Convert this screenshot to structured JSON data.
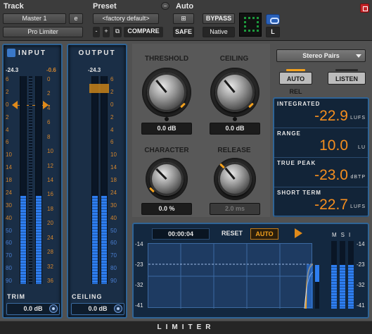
{
  "header": {
    "track_label": "Track",
    "preset_label": "Preset",
    "auto_label": "Auto",
    "track_name": "Master 1",
    "track_e": "e",
    "plugin_name": "Pro Limiter",
    "preset_name": "<factory default>",
    "minus": "-",
    "plus": "+",
    "compare": "COMPARE",
    "safe": "SAFE",
    "bypass": "BYPASS",
    "native": "Native",
    "link_l": "L"
  },
  "input_meter": {
    "title": "INPUT",
    "peak_left": "-24.3",
    "peak_right": "-0.6",
    "scale_orange": [
      "0",
      "2",
      "4",
      "6",
      "8",
      "10",
      "12",
      "14",
      "16",
      "18",
      "20",
      "24",
      "28",
      "32",
      "36"
    ],
    "scale_blue": [
      "50",
      "60",
      "70",
      "80",
      "90"
    ],
    "scale_left": [
      "6",
      "2",
      "0",
      "2",
      "4",
      "6",
      "10",
      "14",
      "18",
      "24",
      "30",
      "40",
      "50",
      "60",
      "70",
      "80",
      "90"
    ],
    "trim_label": "TRIM",
    "trim_value": "0.0 dB"
  },
  "output_meter": {
    "title": "OUTPUT",
    "peak": "-24.3",
    "scale": [
      "6",
      "2",
      "0",
      "2",
      "4",
      "6",
      "10",
      "14",
      "18",
      "24",
      "30",
      "40",
      "50",
      "60",
      "70",
      "80",
      "90"
    ],
    "ceiling_label": "CEILING",
    "ceiling_value": "0.0 dB"
  },
  "knobs": {
    "threshold_label": "THRESHOLD",
    "threshold_value": "0.0 dB",
    "ceiling_label": "CEILING",
    "ceiling_value": "0.0 dB",
    "character_label": "CHARACTER",
    "character_value": "0.0 %",
    "release_label": "RELEASE",
    "release_value": "2.0 ms"
  },
  "controls": {
    "stereo_mode": "Stereo Pairs",
    "auto_rel": "AUTO REL",
    "listen": "LISTEN"
  },
  "loudness": {
    "rows": [
      {
        "label": "INTEGRATED",
        "value": "-22.9",
        "unit": "LUFS"
      },
      {
        "label": "RANGE",
        "value": "10.0",
        "unit": "LU"
      },
      {
        "label": "TRUE PEAK",
        "value": "-23.0",
        "unit": "dBTP"
      },
      {
        "label": "SHORT TERM",
        "value": "-22.7",
        "unit": "LUFS"
      }
    ]
  },
  "history": {
    "time": "00:00:04",
    "reset": "RESET",
    "auto": "AUTO",
    "scale": [
      "-14",
      "-23",
      "-32",
      "-41"
    ],
    "right_scale": [
      "-14",
      "-23",
      "-32",
      "-41"
    ],
    "msi": [
      "M",
      "S",
      "I"
    ]
  },
  "footer": {
    "title": "LIMITER"
  }
}
